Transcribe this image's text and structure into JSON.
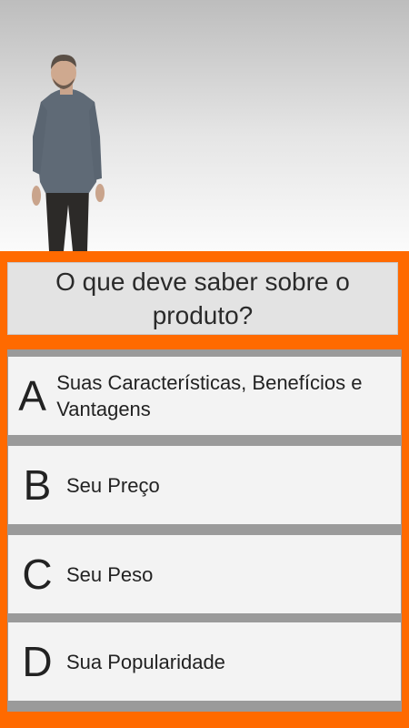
{
  "question": {
    "text": "O que deve saber sobre o produto?"
  },
  "answers": [
    {
      "letter": "A",
      "text": "Suas Características, Benefícios e Vantagens"
    },
    {
      "letter": "B",
      "text": "Seu Preço"
    },
    {
      "letter": "C",
      "text": "Seu Peso"
    },
    {
      "letter": "D",
      "text": "Sua Popularidade"
    }
  ],
  "colors": {
    "frame": "#ff6a00",
    "question_bg": "#e3e3e3",
    "answer_bg": "#f3f3f3",
    "answer_separator": "#9a9a9a"
  }
}
